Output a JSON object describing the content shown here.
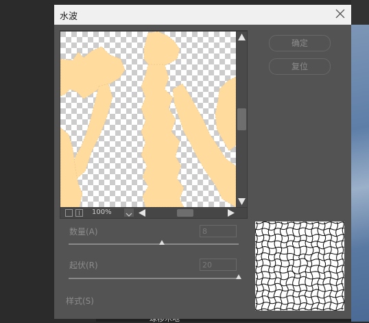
{
  "dialog": {
    "title": "水波",
    "buttons": {
      "ok": "确定",
      "reset": "复位"
    }
  },
  "preview": {
    "zoom": "100%"
  },
  "controls": {
    "amount": {
      "label": "数量(A)",
      "value": "8",
      "fraction": 0.55
    },
    "ridges": {
      "label": "起伏(R)",
      "value": "20",
      "fraction": 1.0
    },
    "style_label": "样式(S)"
  },
  "background": {
    "bottom_text": "球移木地"
  },
  "colors": {
    "shape": "#ffdb9e",
    "panel": "#535353",
    "titlebar": "#f0f0f0"
  }
}
